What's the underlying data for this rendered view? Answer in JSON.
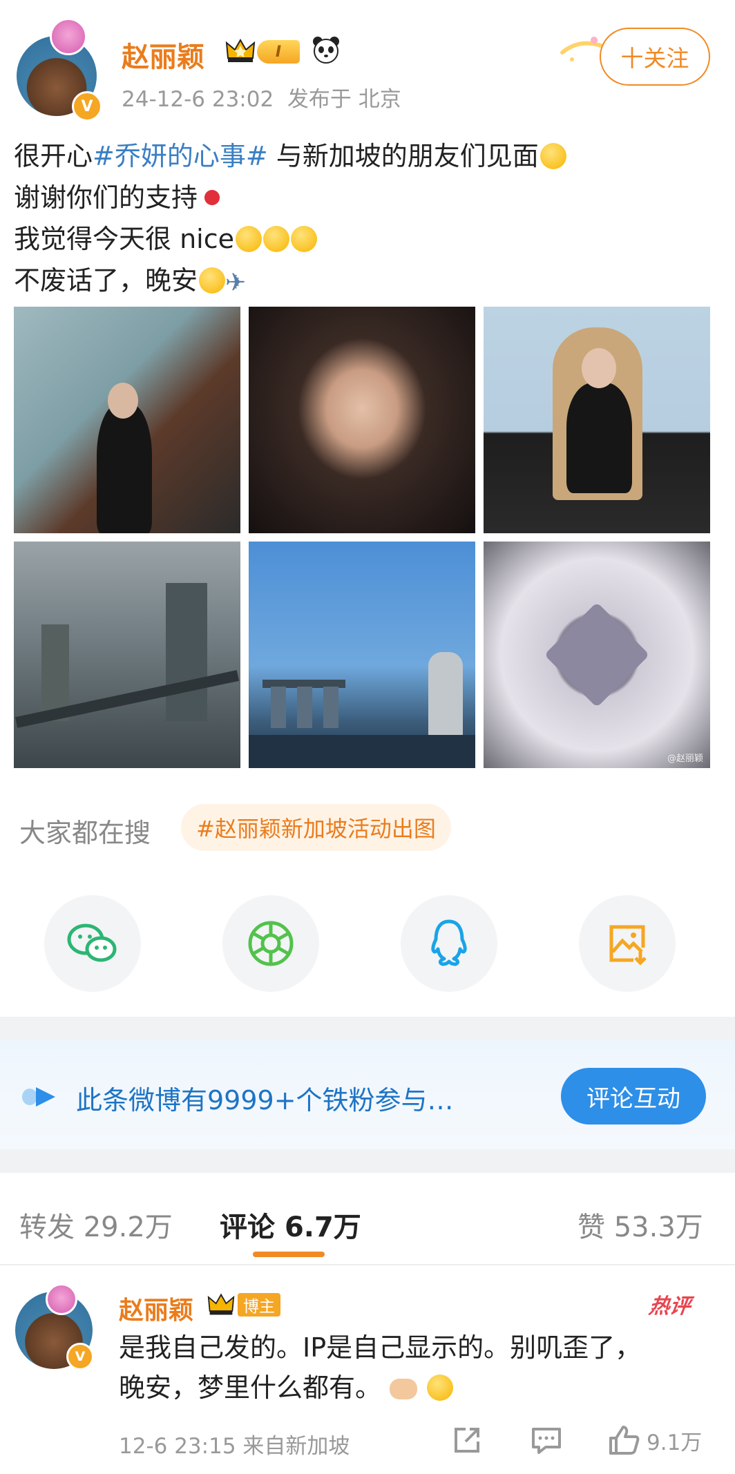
{
  "author": {
    "name": "赵丽颖",
    "level": "I",
    "timestamp": "24-12-6 23:02",
    "location": "发布于 北京",
    "follow_label": "十关注"
  },
  "post": {
    "line1_prefix": "很开心",
    "line1_hashtag": "#乔妍的心事#",
    "line1_suffix": " 与新加坡的朋友们见面",
    "line2": "谢谢你们的支持",
    "line3": "我觉得今天很 nice",
    "line4": "不废话了，晚安"
  },
  "images": {
    "watermark": "@赵丽颖"
  },
  "hot_search": {
    "label": "大家都在搜",
    "topic": "#赵丽颖新加坡活动出图"
  },
  "share_icons": [
    "wechat-icon",
    "moments-icon",
    "qq-icon",
    "save-image-icon"
  ],
  "fans_banner": {
    "text": "此条微博有9999+个铁粉参与…",
    "button": "评论互动"
  },
  "tabs": {
    "repost": {
      "label": "转发",
      "count": "29.2万"
    },
    "comment": {
      "label": "评论",
      "count": "6.7万"
    },
    "like": {
      "label": "赞",
      "count": "53.3万"
    }
  },
  "comment": {
    "name": "赵丽颖",
    "tag": "博主",
    "hot_label": "热评",
    "line1": "是我自己发的。IP是自己显示的。别叽歪了，",
    "line2": "晚安，梦里什么都有。",
    "time": "12-6 23:15",
    "source": "来自新加坡",
    "likes": "9.1万"
  },
  "colors": {
    "accent": "#f08a24",
    "name": "#ea7c1c",
    "hashtag": "#3a7fc4",
    "link_blue": "#1e74c4",
    "button_blue": "#2d8fe8",
    "hot_red": "#e8454f"
  }
}
